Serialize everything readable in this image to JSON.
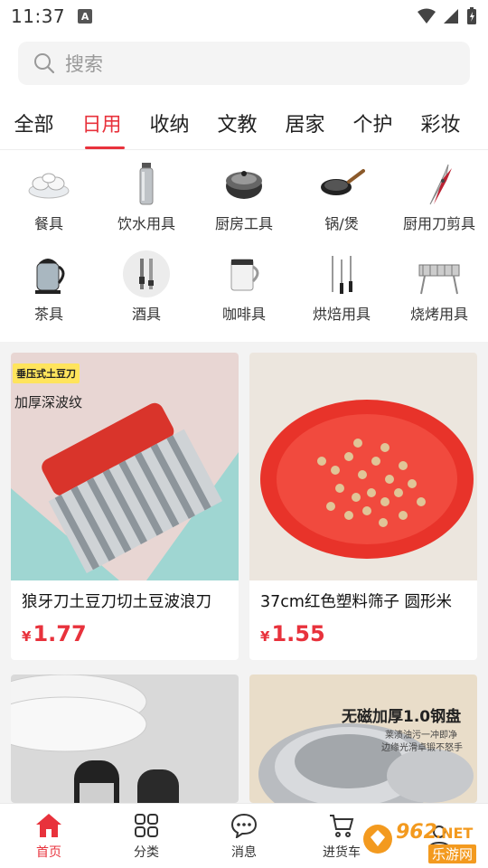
{
  "status": {
    "time": "11:37",
    "indicator": "A"
  },
  "search": {
    "placeholder": "搜索"
  },
  "tabs": [
    {
      "label": "全部"
    },
    {
      "label": "日用",
      "active": true
    },
    {
      "label": "收纳"
    },
    {
      "label": "文教"
    },
    {
      "label": "居家"
    },
    {
      "label": "个护"
    },
    {
      "label": "彩妆"
    }
  ],
  "categories": [
    {
      "label": "餐具",
      "icon": "tableware-icon"
    },
    {
      "label": "饮水用具",
      "icon": "water-bottle-icon"
    },
    {
      "label": "厨房工具",
      "icon": "pot-icon"
    },
    {
      "label": "锅/煲",
      "icon": "wok-icon"
    },
    {
      "label": "厨用刀剪具",
      "icon": "scissors-icon"
    },
    {
      "label": "茶具",
      "icon": "kettle-icon"
    },
    {
      "label": "酒具",
      "icon": "bar-tools-icon"
    },
    {
      "label": "咖啡具",
      "icon": "coffee-mug-icon"
    },
    {
      "label": "烘焙用具",
      "icon": "baking-tools-icon"
    },
    {
      "label": "烧烤用具",
      "icon": "grill-icon"
    }
  ],
  "products": [
    {
      "title": "狼牙刀土豆刀切土豆波浪刀",
      "currency": "¥",
      "price": "1.77",
      "badge": "垂压式土豆刀",
      "caption": "加厚深波纹"
    },
    {
      "title": "37cm红色塑料筛子 圆形米",
      "currency": "¥",
      "price": "1.55"
    },
    {
      "title": "",
      "currency": "",
      "price": ""
    },
    {
      "title": "",
      "currency": "",
      "price": "",
      "caption": "无磁加厚1.0钢盘",
      "subcaption1": "莱渍油污一冲即净",
      "subcaption2": "边缘光滑卓锻不怒手"
    }
  ],
  "bottom_nav": [
    {
      "label": "首页",
      "icon": "home-icon",
      "active": true
    },
    {
      "label": "分类",
      "icon": "category-grid-icon"
    },
    {
      "label": "消息",
      "icon": "message-icon"
    },
    {
      "label": "进货车",
      "icon": "cart-icon"
    }
  ],
  "watermark": {
    "text1": "962",
    "text2": ".NET",
    "text3": "乐游网"
  },
  "colors": {
    "accent": "#e8323c",
    "background": "#f3f3f3"
  }
}
